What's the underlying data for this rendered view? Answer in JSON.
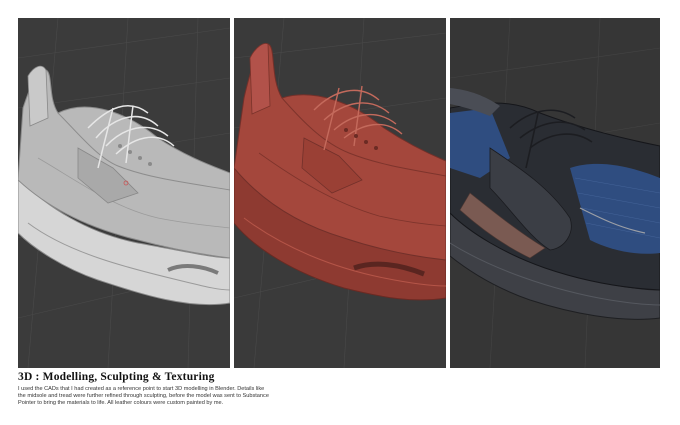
{
  "caption": {
    "title": "3D : Modelling, Sculpting & Texturing",
    "body_lines": [
      "I used the CADs that I had created as a reference point to start 3D modelling in Blender. Details like",
      "the midsole and tread were further refined through sculpting, before the model was sent to Substance",
      "Pointer to bring the materials to life. All leather colours were custom painted by me."
    ]
  },
  "panels": [
    {
      "name": "grey-clay-render",
      "shoe_color": "#bdbdbd",
      "bg": "#3b3b3b"
    },
    {
      "name": "red-clay-render",
      "shoe_color": "#a4473c",
      "bg": "#3a3a3a"
    },
    {
      "name": "textured-render",
      "shoe_color": "#2a2d33",
      "accent": "#2f4d80",
      "bg": "#363636"
    }
  ]
}
